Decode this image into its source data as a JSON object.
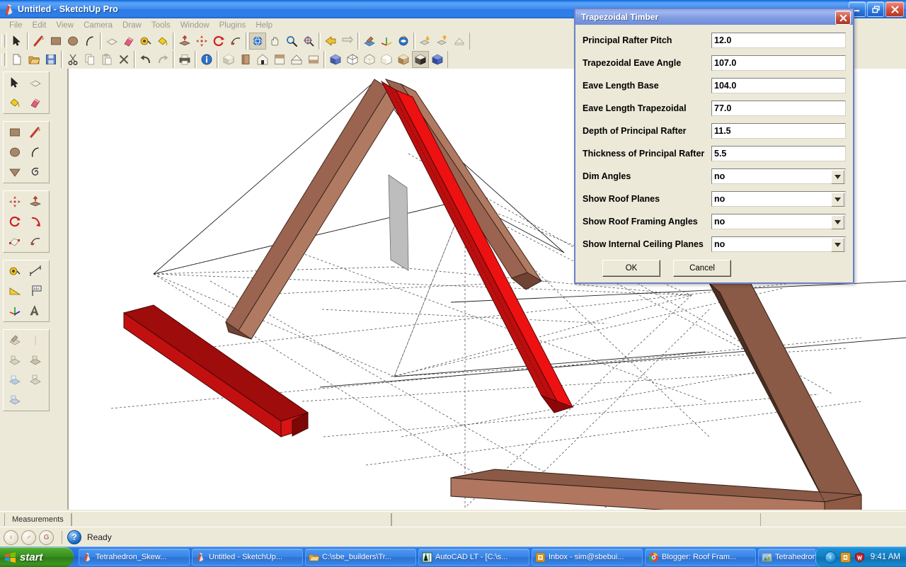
{
  "window": {
    "title": "Untitled - SketchUp Pro",
    "icon": "sketchup-icon",
    "controls": {
      "minimize": "_",
      "maximize": "❐",
      "close": "✕"
    }
  },
  "menubar": {
    "items": [
      {
        "label": "File"
      },
      {
        "label": "Edit"
      },
      {
        "label": "View"
      },
      {
        "label": "Camera"
      },
      {
        "label": "Draw"
      },
      {
        "label": "Tools"
      },
      {
        "label": "Window"
      },
      {
        "label": "Plugins"
      },
      {
        "label": "Help"
      }
    ]
  },
  "toolbar_row1": {
    "groups": [
      {
        "buttons": [
          {
            "name": "select-tool",
            "selected": false
          }
        ]
      },
      {
        "buttons": [
          {
            "name": "line-tool",
            "selected": false
          },
          {
            "name": "rectangle-tool",
            "selected": false
          },
          {
            "name": "circle-tool",
            "selected": false
          },
          {
            "name": "arc-tool",
            "selected": false
          }
        ]
      },
      {
        "buttons": [
          {
            "name": "make-component-tool",
            "selected": false
          },
          {
            "name": "eraser-tool",
            "selected": false
          },
          {
            "name": "tape-measure-tool",
            "selected": false
          },
          {
            "name": "paint-bucket-tool",
            "selected": false
          }
        ]
      },
      {
        "buttons": [
          {
            "name": "push-pull-tool",
            "selected": false
          },
          {
            "name": "move-tool",
            "selected": false
          },
          {
            "name": "rotate-tool",
            "selected": false
          },
          {
            "name": "follow-me-tool",
            "selected": false
          }
        ]
      },
      {
        "buttons": [
          {
            "name": "orbit-tool",
            "selected": true
          },
          {
            "name": "pan-tool",
            "selected": false
          },
          {
            "name": "zoom-tool",
            "selected": false
          },
          {
            "name": "zoom-extents-tool",
            "selected": false
          }
        ]
      },
      {
        "buttons": [
          {
            "name": "previous-view-tool",
            "selected": false
          },
          {
            "name": "next-view-tool",
            "selected": false
          }
        ]
      },
      {
        "buttons": [
          {
            "name": "section-plane-tool",
            "selected": false
          },
          {
            "name": "axes-tool",
            "selected": false
          },
          {
            "name": "position-camera-tool",
            "selected": false
          }
        ]
      },
      {
        "buttons": [
          {
            "name": "get-models-tool",
            "selected": false
          },
          {
            "name": "share-model-tool",
            "selected": false
          },
          {
            "name": "get-photo-texture-tool",
            "selected": false
          }
        ]
      }
    ]
  },
  "toolbar_row2": {
    "groups": [
      {
        "buttons": [
          {
            "name": "new-file-button",
            "selected": false
          },
          {
            "name": "open-file-button",
            "selected": false
          },
          {
            "name": "save-file-button",
            "selected": false
          }
        ]
      },
      {
        "buttons": [
          {
            "name": "cut-button",
            "selected": false
          },
          {
            "name": "copy-button",
            "selected": false
          },
          {
            "name": "paste-button",
            "selected": false
          },
          {
            "name": "delete-button",
            "selected": false
          }
        ]
      },
      {
        "buttons": [
          {
            "name": "undo-button",
            "selected": false
          },
          {
            "name": "redo-button",
            "selected": false
          }
        ]
      },
      {
        "buttons": [
          {
            "name": "print-button",
            "selected": false
          }
        ]
      },
      {
        "buttons": [
          {
            "name": "model-info-button",
            "selected": false
          }
        ]
      },
      {
        "buttons": [
          {
            "name": "iso-view-button",
            "selected": false
          },
          {
            "name": "front-view-button",
            "selected": false
          },
          {
            "name": "right-view-button",
            "selected": false
          },
          {
            "name": "back-view-button",
            "selected": false
          },
          {
            "name": "left-view-button",
            "selected": false
          },
          {
            "name": "top-view-button",
            "selected": false
          }
        ]
      },
      {
        "buttons": [
          {
            "name": "xray-style-button",
            "selected": false
          },
          {
            "name": "wireframe-style-button",
            "selected": false
          },
          {
            "name": "hidden-line-style-button",
            "selected": false
          },
          {
            "name": "shaded-style-button",
            "selected": false
          },
          {
            "name": "shaded-texture-style-button",
            "selected": false
          },
          {
            "name": "monochrome-style-button",
            "selected": true
          },
          {
            "name": "back-edges-style-button",
            "selected": false
          }
        ]
      }
    ]
  },
  "left_palette": {
    "groups": [
      {
        "buttons": [
          {
            "name": "select-tool"
          },
          {
            "name": "make-component-tool"
          },
          {
            "name": "paint-bucket-tool"
          },
          {
            "name": "eraser-tool"
          }
        ]
      },
      {
        "buttons": [
          {
            "name": "rectangle-tool"
          },
          {
            "name": "line-tool"
          },
          {
            "name": "circle-tool"
          },
          {
            "name": "arc-tool"
          },
          {
            "name": "polygon-tool"
          },
          {
            "name": "freehand-tool"
          }
        ]
      },
      {
        "buttons": [
          {
            "name": "move-tool"
          },
          {
            "name": "push-pull-tool"
          },
          {
            "name": "rotate-tool"
          },
          {
            "name": "follow-me-tool"
          },
          {
            "name": "scale-tool"
          },
          {
            "name": "offset-tool"
          }
        ]
      },
      {
        "buttons": [
          {
            "name": "tape-measure-tool"
          },
          {
            "name": "dimension-tool"
          },
          {
            "name": "protractor-tool"
          },
          {
            "name": "text-tool"
          },
          {
            "name": "axes-tool"
          },
          {
            "name": "3d-text-tool"
          }
        ]
      },
      {
        "buttons": [
          {
            "name": "section-plane-tool"
          },
          {
            "name": "walkthrough-tool"
          },
          {
            "name": "look-around-tool"
          },
          {
            "name": "position-camera-tool"
          },
          {
            "name": "orbit-tool"
          },
          {
            "name": "pan-tool"
          }
        ]
      }
    ]
  },
  "measurements": {
    "tab_label": "Measurements",
    "value": ""
  },
  "statusbar": {
    "buttons": [
      {
        "name": "geo-location-button",
        "glyph": "♀"
      },
      {
        "name": "credits-button",
        "glyph": "♂"
      },
      {
        "name": "google-button",
        "glyph": "G"
      }
    ],
    "help_icon": "?",
    "text": "Ready"
  },
  "dialog": {
    "title": "Trapezoidal Timber",
    "close_label": "✕",
    "fields": [
      {
        "label": "Principal Rafter Pitch",
        "value": "12.0",
        "type": "text",
        "name": "principal-rafter-pitch"
      },
      {
        "label": "Trapezoidal Eave Angle",
        "value": "107.0",
        "type": "text",
        "name": "trapezoidal-eave-angle"
      },
      {
        "label": "Eave Length Base",
        "value": "104.0",
        "type": "text",
        "name": "eave-length-base"
      },
      {
        "label": "Eave Length Trapezoidal",
        "value": "77.0",
        "type": "text",
        "name": "eave-length-trapezoidal"
      },
      {
        "label": "Depth of Principal Rafter",
        "value": "11.5",
        "type": "text",
        "name": "depth-of-principal-rafter"
      },
      {
        "label": "Thickness of Principal Rafter",
        "value": "5.5",
        "type": "text",
        "name": "thickness-of-principal-rafter"
      },
      {
        "label": "Dim Angles",
        "value": "no",
        "type": "select",
        "name": "dim-angles"
      },
      {
        "label": "Show Roof Planes",
        "value": "no",
        "type": "select",
        "name": "show-roof-planes"
      },
      {
        "label": "Show Roof Framing Angles",
        "value": "no",
        "type": "select",
        "name": "show-roof-framing-angles"
      },
      {
        "label": "Show Internal Ceiling Planes",
        "value": "no",
        "type": "select",
        "name": "show-internal-ceiling-planes"
      }
    ],
    "ok_label": "OK",
    "cancel_label": "Cancel"
  },
  "taskbar": {
    "start_label": "start",
    "tasks": [
      {
        "label": "Tetrahedron_Skew...",
        "icon": "sketchup-icon"
      },
      {
        "label": "Untitled - SketchUp...",
        "icon": "sketchup-icon"
      },
      {
        "label": "C:\\sbe_builders\\Tr...",
        "icon": "folder-icon"
      },
      {
        "label": "AutoCAD LT - [C:\\s...",
        "icon": "autocad-icon"
      },
      {
        "label": "Inbox - sim@sbebui...",
        "icon": "mail-icon"
      },
      {
        "label": "Blogger: Roof Fram...",
        "icon": "browser-icon"
      },
      {
        "label": "Tetrahedron_Skew...",
        "icon": "image-icon"
      }
    ],
    "tray": {
      "chevron": "‹",
      "icons": [
        {
          "name": "tray-orange-icon"
        },
        {
          "name": "tray-shield-icon"
        }
      ],
      "clock": "9:41 AM"
    }
  },
  "colors": {
    "timber_brown_top": "#8a5a47",
    "timber_brown_side": "#a9705a",
    "timber_brown_light": "#b0765f",
    "timber_red_bright": "#ee1111",
    "timber_red_dark": "#bb0e0e",
    "canvas_bg": "#ffffff",
    "chrome_bg": "#ece9d8",
    "title_blue": "#2c7ae6",
    "dialog_border": "#6b80c8"
  }
}
